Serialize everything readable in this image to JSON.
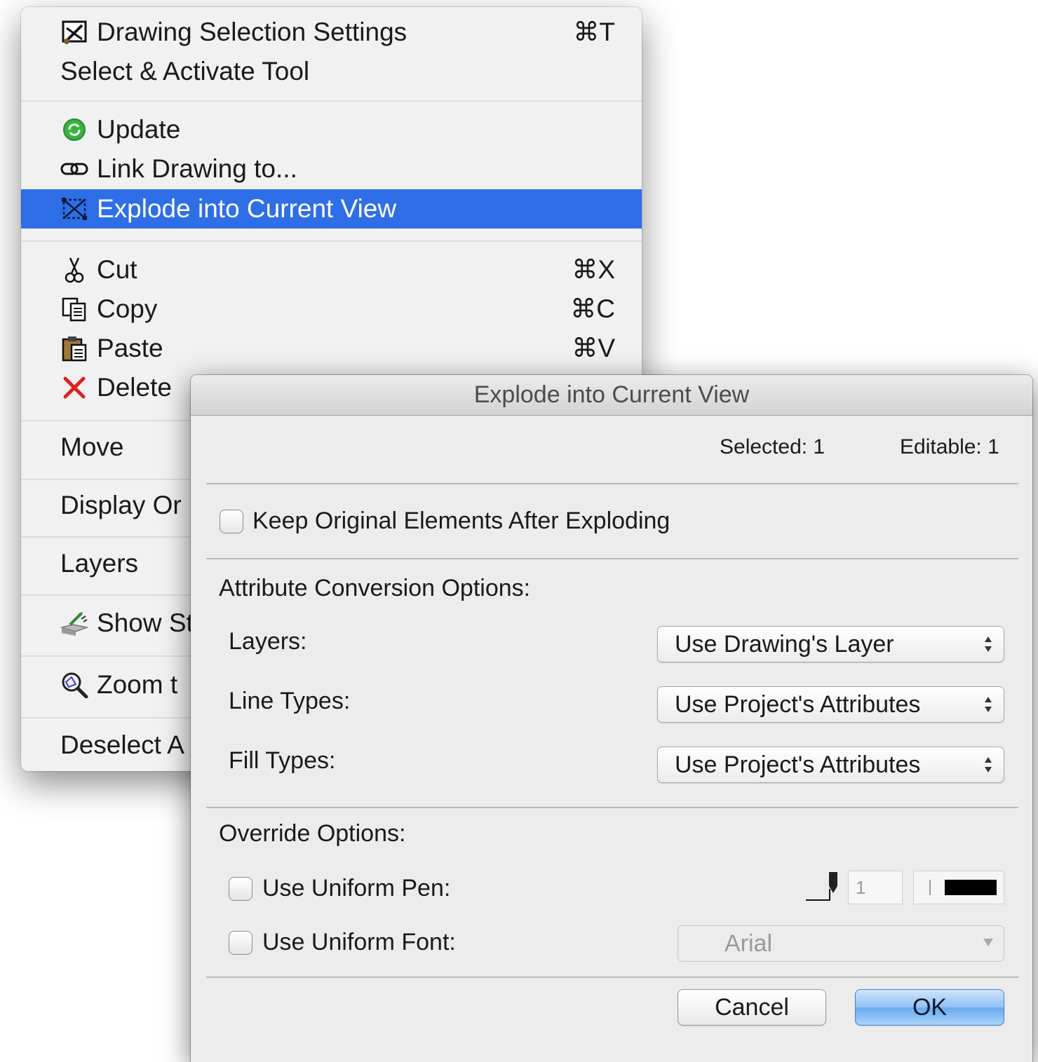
{
  "menu": {
    "items": [
      {
        "label": "Drawing Selection Settings",
        "shortcut": "⌘T",
        "icon": "drawing-settings-icon"
      },
      {
        "label": "Select & Activate Tool"
      },
      {
        "label": "Update",
        "icon": "update-icon"
      },
      {
        "label": "Link Drawing to...",
        "icon": "link-icon"
      },
      {
        "label": "Explode into Current View",
        "icon": "explode-icon",
        "highlighted": true
      },
      {
        "label": "Cut",
        "shortcut": "⌘X",
        "icon": "scissors-icon"
      },
      {
        "label": "Copy",
        "shortcut": "⌘C",
        "icon": "copy-icon"
      },
      {
        "label": "Paste",
        "shortcut": "⌘V",
        "icon": "paste-icon"
      },
      {
        "label": "Delete",
        "icon": "delete-icon"
      },
      {
        "label": "Move"
      },
      {
        "label": "Display Or"
      },
      {
        "label": "Layers"
      },
      {
        "label": "Show St",
        "icon": "show-icon"
      },
      {
        "label": "Zoom t",
        "icon": "zoom-icon"
      },
      {
        "label": "Deselect A"
      }
    ]
  },
  "dialog": {
    "title": "Explode into Current View",
    "selected": "Selected: 1",
    "editable": "Editable: 1",
    "keep_original": "Keep Original Elements After Exploding",
    "attr_heading": "Attribute Conversion Options:",
    "layers_label": "Layers:",
    "layers_value": "Use Drawing's Layer",
    "linetypes_label": "Line Types:",
    "linetypes_value": "Use Project's Attributes",
    "filltypes_label": "Fill Types:",
    "filltypes_value": "Use Project's Attributes",
    "override_heading": "Override  Options:",
    "uniform_pen": "Use Uniform Pen:",
    "pen_number": "1",
    "uniform_font": "Use Uniform Font:",
    "font_value": "Arial",
    "cancel": "Cancel",
    "ok": "OK"
  },
  "colors": {
    "highlight": "#2e6ee6",
    "menu_bg": "#f1f1f1",
    "dialog_bg": "#ececec",
    "delete_red": "#e02020",
    "update_green": "#3cb043"
  }
}
